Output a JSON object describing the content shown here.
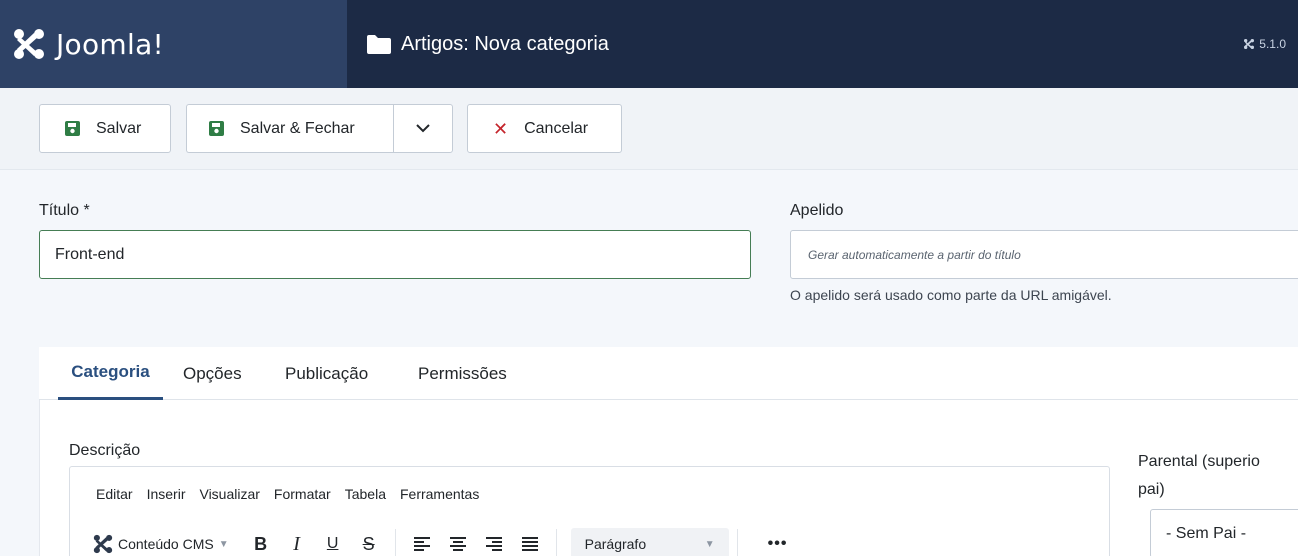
{
  "header": {
    "logo_text": "Joomla!",
    "page_title": "Artigos: Nova categoria",
    "version": "5.1.0"
  },
  "toolbar": {
    "save_label": "Salvar",
    "save_close_label": "Salvar & Fechar",
    "cancel_label": "Cancelar"
  },
  "form": {
    "title_label": "Título *",
    "title_value": "Front-end",
    "alias_label": "Apelido",
    "alias_placeholder": "Gerar automaticamente a partir do título",
    "alias_help": "O apelido será usado como parte da URL amigável."
  },
  "tabs": [
    {
      "label": "Categoria",
      "active": true
    },
    {
      "label": "Opções",
      "active": false
    },
    {
      "label": "Publicação",
      "active": false
    },
    {
      "label": "Permissões",
      "active": false
    }
  ],
  "editor": {
    "description_label": "Descrição",
    "menu": [
      "Editar",
      "Inserir",
      "Visualizar",
      "Formatar",
      "Tabela",
      "Ferramentas"
    ],
    "cms_content_label": "Conteúdo CMS",
    "format_buttons": [
      "B",
      "I",
      "U",
      "S"
    ],
    "paragraph_select": "Parágrafo",
    "more_label": "•••"
  },
  "sidebar": {
    "parent_label_line1": "Parental (superio",
    "parent_label_line2": "pai)",
    "parent_value": "- Sem Pai -"
  },
  "colors": {
    "header_bg": "#1c2a45",
    "logo_bg": "#2e4266",
    "save_icon": "#2f7d45",
    "cancel_icon": "#c4242b",
    "active_tab": "#2a4f7f"
  }
}
